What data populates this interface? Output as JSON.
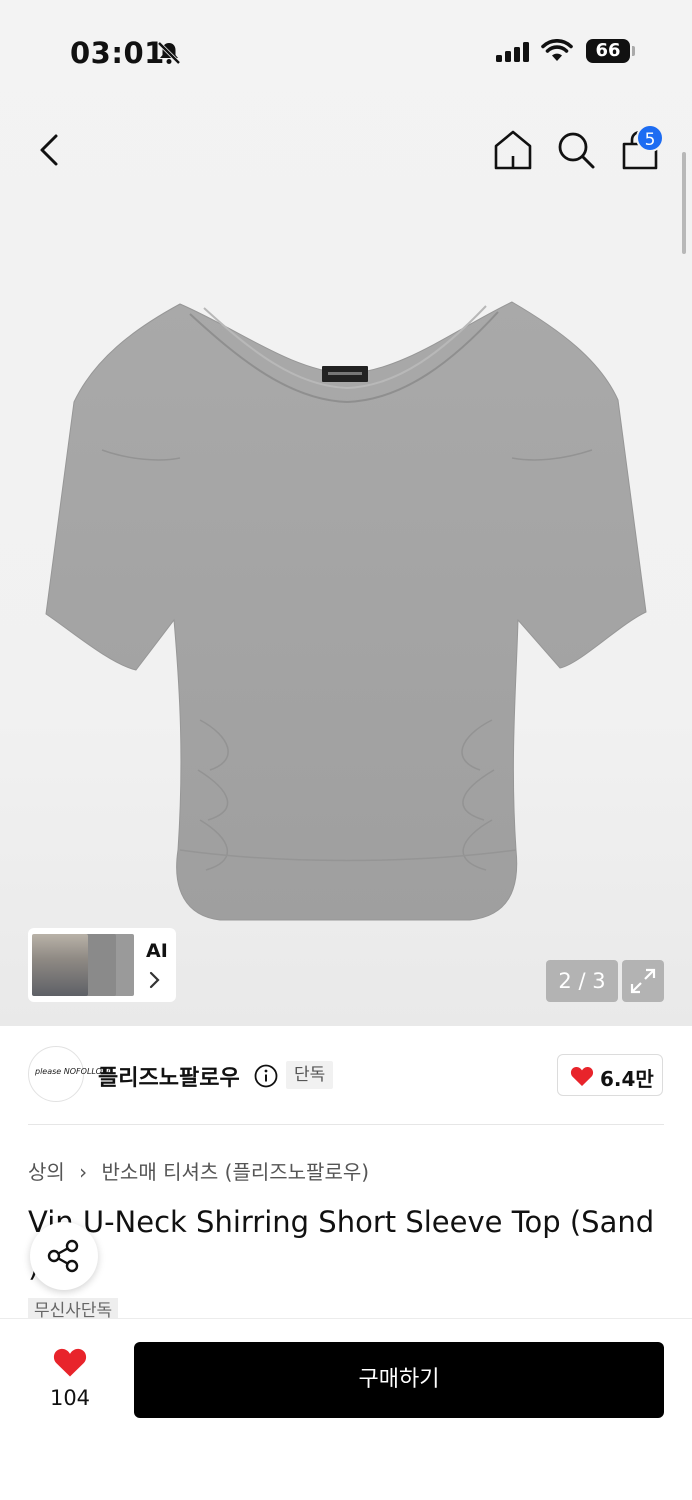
{
  "status_bar": {
    "time": "03:01",
    "battery": "66"
  },
  "header": {
    "cart_count": "5"
  },
  "gallery": {
    "ai_label": "AI",
    "page_indicator": "2 / 3"
  },
  "brand": {
    "name": "플리즈노팔로우",
    "exclusive_badge": "단독",
    "like_count": "6.4만",
    "logo_text": "please NOFOLLOW"
  },
  "breadcrumb": {
    "category": "상의",
    "subcategory": "반소매 티셔츠 (플리즈노팔로우)"
  },
  "product": {
    "title": "Vin U-Neck Shirring Short Sleeve Top (Sand )",
    "tag": "무신사단독"
  },
  "bottom_bar": {
    "wish_count": "104",
    "buy_label": "구매하기"
  },
  "colors": {
    "accent_red": "#e8242b",
    "badge_blue": "#1d6cf2",
    "buy_button": "#000000"
  }
}
